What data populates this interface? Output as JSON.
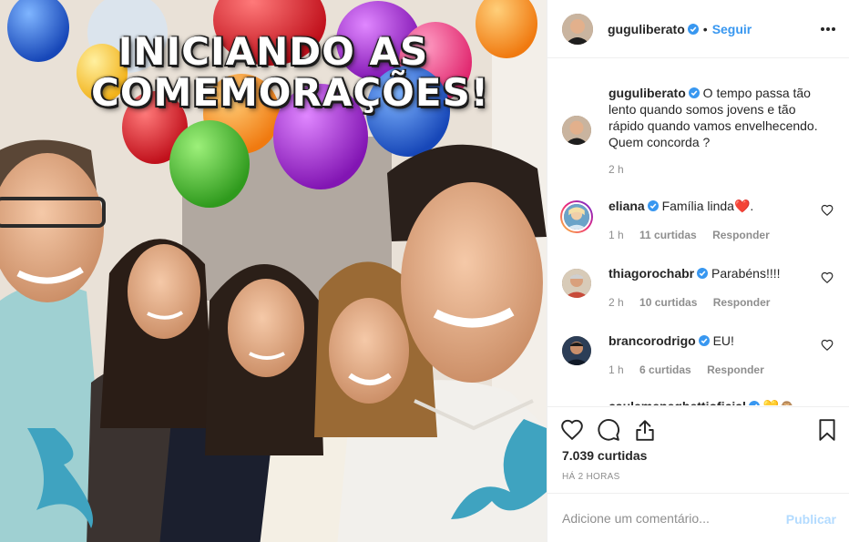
{
  "post": {
    "banner_line1": "INICIANDO AS",
    "banner_line2": "COMEMORAÇÕES!"
  },
  "header": {
    "username": "guguliberato",
    "verified": true,
    "separator": "•",
    "follow_label": "Seguir",
    "more_icon": "ellipsis-icon"
  },
  "caption": {
    "username": "guguliberato",
    "text": "O tempo passa tão lento quando somos jovens e tão rápido quando vamos envelhecendo. Quem concorda ?",
    "time": "2 h"
  },
  "comments": [
    {
      "username": "eliana",
      "text": "Família linda❤️.",
      "time": "1 h",
      "likes": "11 curtidas",
      "reply": "Responder"
    },
    {
      "username": "thiagorochabr",
      "text": "Parabéns!!!!",
      "time": "2 h",
      "likes": "10 curtidas",
      "reply": "Responder"
    },
    {
      "username": "brancorodrigo",
      "text": "EU!",
      "time": "1 h",
      "likes": "6 curtidas",
      "reply": "Responder"
    },
    {
      "username": "caulemeneghettioficial",
      "text": "💛🙈"
    }
  ],
  "actions": {
    "like_icon": "heart-icon",
    "comment_icon": "comment-icon",
    "share_icon": "share-icon",
    "save_icon": "bookmark-icon"
  },
  "stats": {
    "likes": "7.039 curtidas",
    "posted": "HÁ 2 HORAS"
  },
  "add_comment": {
    "placeholder": "Adicione um comentário...",
    "publish_label": "Publicar"
  },
  "colors": {
    "link_blue": "#3897f0",
    "publish_disabled": "#b3dbff",
    "verified_blue": "#3897f0",
    "border": "#efefef"
  }
}
